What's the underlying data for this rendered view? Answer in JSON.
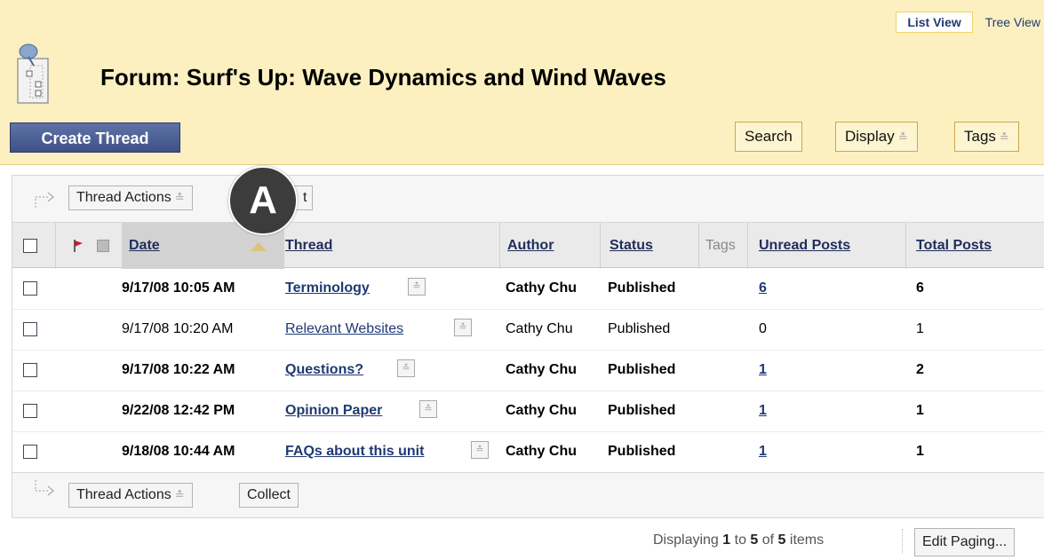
{
  "header": {
    "view_toggle": {
      "list": "List View",
      "tree": "Tree View"
    },
    "title": "Forum: Surf's Up: Wave Dynamics and Wind Waves",
    "create_button": "Create Thread",
    "search_button": "Search",
    "display_button": "Display",
    "tags_button": "Tags"
  },
  "annotation_badge": "A",
  "action_bar_top": {
    "thread_actions": "Thread Actions",
    "collect_partial": "t"
  },
  "action_bar_bottom": {
    "thread_actions": "Thread Actions",
    "collect": "Collect"
  },
  "table": {
    "columns": {
      "date": "Date",
      "thread": "Thread",
      "author": "Author",
      "status": "Status",
      "tags": "Tags",
      "unread": "Unread Posts",
      "total": "Total Posts"
    },
    "rows": [
      {
        "date": "9/17/08 10:05 AM",
        "thread": "Terminology",
        "author": "Cathy Chu",
        "status": "Published",
        "unread": "6",
        "total": "6",
        "bold": true
      },
      {
        "date": "9/17/08 10:20 AM",
        "thread": "Relevant Websites",
        "author": "Cathy Chu",
        "status": "Published",
        "unread": "0",
        "total": "1",
        "bold": false
      },
      {
        "date": "9/17/08 10:22 AM",
        "thread": "Questions?",
        "author": "Cathy Chu",
        "status": "Published",
        "unread": "1",
        "total": "2",
        "bold": true
      },
      {
        "date": "9/22/08 12:42 PM",
        "thread": "Opinion Paper",
        "author": "Cathy Chu",
        "status": "Published",
        "unread": "1",
        "total": "1",
        "bold": true
      },
      {
        "date": "9/18/08 10:44 AM",
        "thread": "FAQs about this unit",
        "author": "Cathy Chu",
        "status": "Published",
        "unread": "1",
        "total": "1",
        "bold": true
      }
    ]
  },
  "paging": {
    "prefix": "Displaying ",
    "from": "1",
    "mid1": " to ",
    "to": "5",
    "mid2": " of ",
    "total": "5",
    "suffix": " items",
    "edit_button": "Edit Paging..."
  },
  "colors": {
    "header_bg": "#fcf0c0",
    "create_button_bg": "#4a5c93",
    "link": "#1f3a73"
  }
}
